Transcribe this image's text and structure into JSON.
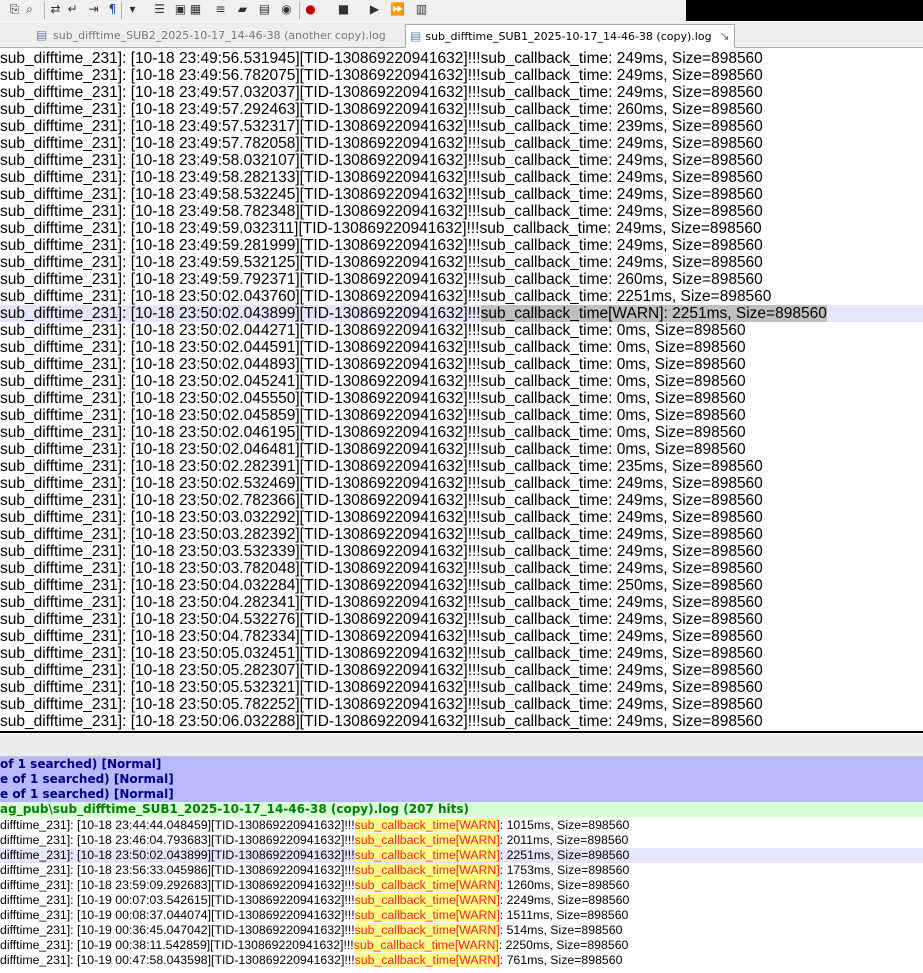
{
  "toolbar": {
    "icons": [
      "copy-icon",
      "find-icon",
      "replace-icon",
      "wrap-icon",
      "indent-icon",
      "show-all-chars-icon",
      "chevron-down-icon",
      "indent-guide-icon",
      "bookmark-icon",
      "document-map-icon",
      "function-list-icon",
      "folder-icon",
      "clipboard-icon",
      "eye-icon",
      "record-icon",
      "stop-icon",
      "play-icon",
      "run-multiple-icon",
      "save-macro-icon"
    ]
  },
  "tabs": [
    {
      "label": "sub_difftime_SUB2_2025-10-17_14-46-38 (another copy).log",
      "active": false
    },
    {
      "label": "sub_difftime_SUB1_2025-10-17_14-46-38 (copy).log",
      "active": true
    }
  ],
  "editor": {
    "prefix": "sub_difftime_231]: [",
    "tid": "][TID-13086922094163",
    "tid_tail": "2]",
    "marker": "!!!",
    "callback": "sub_callback_time",
    "lines": [
      {
        "ts": "10-18 23:49:56.531945",
        "rest": ": 249ms, Size=898560"
      },
      {
        "ts": "10-18 23:49:56.782075",
        "rest": ": 249ms, Size=898560"
      },
      {
        "ts": "10-18 23:49:57.032037",
        "rest": ": 249ms, Size=898560"
      },
      {
        "ts": "10-18 23:49:57.292463",
        "rest": ": 260ms, Size=898560"
      },
      {
        "ts": "10-18 23:49:57.532317",
        "rest": ": 239ms, Size=898560"
      },
      {
        "ts": "10-18 23:49:57.782058",
        "rest": ": 249ms, Size=898560"
      },
      {
        "ts": "10-18 23:49:58.032107",
        "rest": ": 249ms, Size=898560"
      },
      {
        "ts": "10-18 23:49:58.282133",
        "rest": ": 249ms, Size=898560"
      },
      {
        "ts": "10-18 23:49:58.532245",
        "rest": ": 249ms, Size=898560"
      },
      {
        "ts": "10-18 23:49:58.782348",
        "rest": ": 249ms, Size=898560"
      },
      {
        "ts": "10-18 23:49:59.032311",
        "rest": ": 249ms, Size=898560"
      },
      {
        "ts": "10-18 23:49:59.281999",
        "rest": ": 249ms, Size=898560"
      },
      {
        "ts": "10-18 23:49:59.532125",
        "rest": ": 249ms, Size=898560"
      },
      {
        "ts": "10-18 23:49:59.792371",
        "rest": ": 260ms, Size=898560"
      },
      {
        "ts": "10-18 23:50:02.043760",
        "rest": ": 2251ms, Size=898560"
      },
      {
        "ts": "10-18 23:50:02.043899",
        "rest": "[WARN]: 2251ms, Size=898560",
        "current": true
      },
      {
        "ts": "10-18 23:50:02.044271",
        "rest": ": 0ms, Size=898560"
      },
      {
        "ts": "10-18 23:50:02.044591",
        "rest": ": 0ms, Size=898560"
      },
      {
        "ts": "10-18 23:50:02.044893",
        "rest": ": 0ms, Size=898560"
      },
      {
        "ts": "10-18 23:50:02.045241",
        "rest": ": 0ms, Size=898560"
      },
      {
        "ts": "10-18 23:50:02.045550",
        "rest": ": 0ms, Size=898560"
      },
      {
        "ts": "10-18 23:50:02.045859",
        "rest": ": 0ms, Size=898560"
      },
      {
        "ts": "10-18 23:50:02.046195",
        "rest": ": 0ms, Size=898560"
      },
      {
        "ts": "10-18 23:50:02.046481",
        "rest": ": 0ms, Size=898560"
      },
      {
        "ts": "10-18 23:50:02.282391",
        "rest": ": 235ms, Size=898560"
      },
      {
        "ts": "10-18 23:50:02.532469",
        "rest": ": 249ms, Size=898560"
      },
      {
        "ts": "10-18 23:50:02.782366",
        "rest": ": 249ms, Size=898560"
      },
      {
        "ts": "10-18 23:50:03.032292",
        "rest": ": 249ms, Size=898560"
      },
      {
        "ts": "10-18 23:50:03.282392",
        "rest": ": 249ms, Size=898560"
      },
      {
        "ts": "10-18 23:50:03.532339",
        "rest": ": 249ms, Size=898560"
      },
      {
        "ts": "10-18 23:50:03.782048",
        "rest": ": 249ms, Size=898560"
      },
      {
        "ts": "10-18 23:50:04.032284",
        "rest": ": 250ms, Size=898560"
      },
      {
        "ts": "10-18 23:50:04.282341",
        "rest": ": 249ms, Size=898560"
      },
      {
        "ts": "10-18 23:50:04.532276",
        "rest": ": 249ms, Size=898560"
      },
      {
        "ts": "10-18 23:50:04.782334",
        "rest": ": 249ms, Size=898560"
      },
      {
        "ts": "10-18 23:50:05.032451",
        "rest": ": 249ms, Size=898560"
      },
      {
        "ts": "10-18 23:50:05.282307",
        "rest": ": 249ms, Size=898560"
      },
      {
        "ts": "10-18 23:50:05.532321",
        "rest": ": 249ms, Size=898560"
      },
      {
        "ts": "10-18 23:50:05.782252",
        "rest": ": 249ms, Size=898560"
      },
      {
        "ts": "10-18 23:50:06.032288",
        "rest": ": 249ms, Size=898560"
      }
    ]
  },
  "results": {
    "headers": [
      "of 1 searched) [Normal]",
      "e of 1 searched) [Normal]",
      "e of 1 searched) [Normal]"
    ],
    "file_line": "ag_pub\\sub_difftime_SUB1_2025-10-17_14-46-38 (copy).log (207 hits)",
    "prefix": "difftime_231]: [",
    "tid": "][TID-130869220941632]!!!",
    "hit": "sub_callback_time[WARN]",
    "hits": [
      {
        "ts": "10-18 23:44:44.048459",
        "rest": ": 1015ms, Size=898560"
      },
      {
        "ts": "10-18 23:46:04.793683",
        "rest": ": 2011ms, Size=898560"
      },
      {
        "ts": "10-18 23:50:02.043899",
        "rest": ": 2251ms, Size=898560",
        "current": true
      },
      {
        "ts": "10-18 23:56:33.045986",
        "rest": ": 1753ms, Size=898560"
      },
      {
        "ts": "10-18 23:59:09.292683",
        "rest": ": 1260ms, Size=898560"
      },
      {
        "ts": "10-19 00:07:03.542615",
        "rest": ": 2249ms, Size=898560"
      },
      {
        "ts": "10-19 00:08:37.044074",
        "rest": ": 1511ms, Size=898560"
      },
      {
        "ts": "10-19 00:36:45.047042",
        "rest": ": 514ms, Size=898560"
      },
      {
        "ts": "10-19 00:38:11.542859",
        "rest": ": 2250ms, Size=898560"
      },
      {
        "ts": "10-19 00:47:58.043598",
        "rest": ": 761ms, Size=898560"
      }
    ]
  }
}
